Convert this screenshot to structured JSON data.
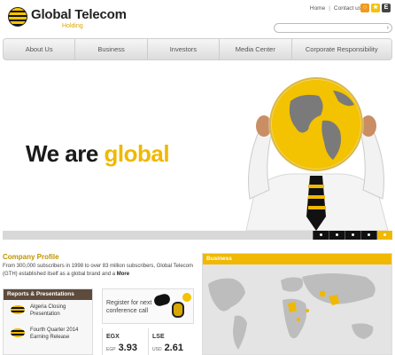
{
  "header": {
    "logo_title": "Global Telecom",
    "logo_sub": "Holding",
    "links": [
      "Home",
      "Contact us"
    ],
    "icons": [
      "rss-icon",
      "favorite-icon",
      "external-icon"
    ],
    "search_button": "›"
  },
  "nav": {
    "items": [
      "About Us",
      "Business",
      "Investors",
      "Media Center",
      "Corporate Responsibility"
    ]
  },
  "hero": {
    "text_a": "We are ",
    "text_b": "global",
    "slides": 5,
    "active_slide": 5
  },
  "profile": {
    "title": "Company Profile",
    "text": "From 300,000 subscribers in 1998 to over 83 million subscribers, Global Telecom (GTH) established itself as a global brand and a",
    "more": "More"
  },
  "reports": {
    "title": "Reports & Presentations",
    "items": [
      "Algeria Closing Presentation",
      "Fourth Quarter 2014 Earning Release"
    ]
  },
  "register": {
    "text": "Register for next conference call"
  },
  "stocks": [
    {
      "name": "EGX",
      "currency": "EGP",
      "value": "3.93"
    },
    {
      "name": "LSE",
      "currency": "USD",
      "value": "2.61"
    }
  ],
  "business": {
    "title": "Business"
  },
  "colors": {
    "brand_yellow": "#f0b800",
    "dark": "#1a1a1a",
    "brown": "#5e4b3c"
  }
}
